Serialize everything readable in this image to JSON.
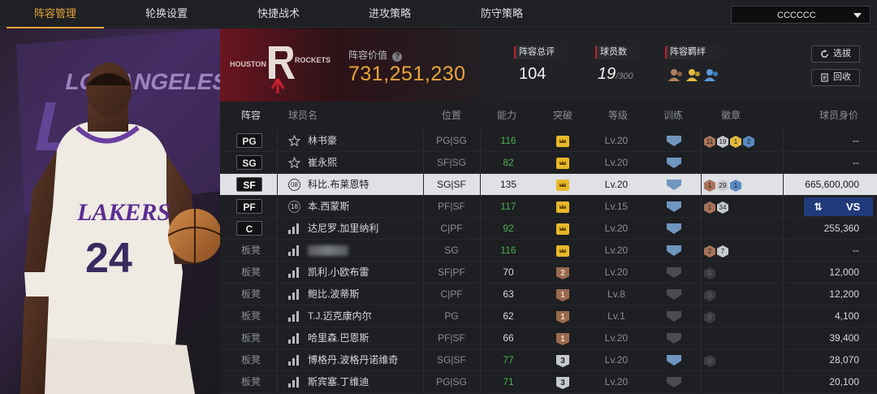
{
  "tabs": [
    {
      "label": "阵容管理",
      "active": true
    },
    {
      "label": "轮换设置",
      "active": false
    },
    {
      "label": "快捷战术",
      "active": false
    },
    {
      "label": "进攻策略",
      "active": false
    },
    {
      "label": "防守策略",
      "active": false
    }
  ],
  "user_select": {
    "value": "CCCCCC"
  },
  "hero": {
    "team_text": "LOS ANGELES LAKERS",
    "jersey_team": "LAKERS",
    "jersey_number": "24"
  },
  "team": {
    "logo_left": "HOUSTON",
    "logo_right": "ROCKETS",
    "value_label": "阵容价值",
    "value": "731,251,230",
    "stats": [
      {
        "label": "阵容总评",
        "value": "104",
        "sub": ""
      },
      {
        "label": "球员数",
        "value": "19",
        "sub": "/300"
      },
      {
        "label": "阵容羁绊",
        "value": "",
        "sub": ""
      }
    ],
    "buttons": {
      "draft": "选拔",
      "recycle": "回收"
    }
  },
  "columns": [
    "阵容",
    "球员名",
    "位置",
    "能力",
    "突破",
    "等级",
    "训练",
    "徽章",
    "球员身价"
  ],
  "vs_button": {
    "label": "VS"
  },
  "rows": [
    {
      "slot": "PG",
      "icon": "star",
      "name": "林书豪",
      "pos": "PG|SG",
      "ovr": "116",
      "green": true,
      "brk": "crown",
      "lv": "Lv.20",
      "train": true,
      "badges": [
        [
          "11",
          "bronze"
        ],
        [
          "19",
          "silver"
        ],
        [
          "1",
          "gold"
        ],
        [
          "2",
          "blue"
        ]
      ],
      "price": "--",
      "selected": false
    },
    {
      "slot": "SG",
      "icon": "star",
      "name": "崔永熙",
      "pos": "SF|SG",
      "ovr": "82",
      "green": true,
      "brk": "crown",
      "lv": "Lv.20",
      "train": true,
      "badges": [],
      "price": "--",
      "selected": false
    },
    {
      "slot": "SF",
      "icon": "08",
      "name": "科比.布莱恩特",
      "pos": "SG|SF",
      "ovr": "135",
      "green": false,
      "brk": "crown",
      "lv": "Lv.20",
      "train": true,
      "badges": [
        [
          "1",
          "bronze"
        ],
        [
          "29",
          "silver"
        ],
        [
          "1",
          "blue"
        ]
      ],
      "price": "665,600,000",
      "selected": true
    },
    {
      "slot": "PF",
      "icon": "18",
      "name": "本.西蒙斯",
      "pos": "PF|SF",
      "ovr": "117",
      "green": true,
      "brk": "crown",
      "lv": "Lv.15",
      "train": true,
      "badges": [
        [
          "1",
          "bronze"
        ],
        [
          "34",
          "silver"
        ]
      ],
      "price": "",
      "selected": false,
      "vs": true
    },
    {
      "slot": "C",
      "icon": "bars",
      "name": "达尼罗.加里纳利",
      "pos": "C|PF",
      "ovr": "92",
      "green": true,
      "brk": "crown",
      "lv": "Lv.20",
      "train": true,
      "badges": [],
      "price": "255,360",
      "selected": false
    },
    {
      "slot": "板凳",
      "icon": "bars",
      "name": "",
      "pos": "SG",
      "ovr": "116",
      "green": true,
      "brk": "crown",
      "lv": "Lv.20",
      "train": true,
      "badges": [
        [
          "2",
          "bronze"
        ],
        [
          "7",
          "silver"
        ]
      ],
      "price": "--",
      "selected": false,
      "blurred": true
    },
    {
      "slot": "板凳",
      "icon": "bars",
      "name": "凯利.小欧布雷",
      "pos": "SF|PF",
      "ovr": "70",
      "green": false,
      "brk": "2",
      "lv": "Lv.20",
      "train": false,
      "badges": [
        [
          "0",
          "dim"
        ]
      ],
      "price": "12,000",
      "selected": false
    },
    {
      "slot": "板凳",
      "icon": "bars",
      "name": "鲍比.波蒂斯",
      "pos": "C|PF",
      "ovr": "63",
      "green": false,
      "brk": "1",
      "lv": "Lv.8",
      "train": false,
      "badges": [
        [
          "0",
          "dim"
        ]
      ],
      "price": "12,200",
      "selected": false
    },
    {
      "slot": "板凳",
      "icon": "bars",
      "name": "T.J.迈克康内尔",
      "pos": "PG",
      "ovr": "62",
      "green": false,
      "brk": "1",
      "lv": "Lv.1",
      "train": false,
      "badges": [
        [
          "0",
          "dim"
        ]
      ],
      "price": "4,100",
      "selected": false
    },
    {
      "slot": "板凳",
      "icon": "bars",
      "name": "哈里森.巴恩斯",
      "pos": "PF|SF",
      "ovr": "66",
      "green": false,
      "brk": "1",
      "lv": "Lv.20",
      "train": false,
      "badges": [],
      "price": "39,400",
      "selected": false
    },
    {
      "slot": "板凳",
      "icon": "bars",
      "name": "博格丹.波格丹诺维奇",
      "pos": "SG|SF",
      "ovr": "77",
      "green": true,
      "brk": "3",
      "lv": "Lv.20",
      "train": true,
      "badges": [
        [
          "0",
          "dim"
        ]
      ],
      "price": "28,070",
      "selected": false
    },
    {
      "slot": "板凳",
      "icon": "bars",
      "name": "斯宾塞.丁维迪",
      "pos": "PG|SG",
      "ovr": "71",
      "green": true,
      "brk": "3",
      "lv": "Lv.20",
      "train": false,
      "badges": [],
      "price": "20,100",
      "selected": false
    }
  ]
}
